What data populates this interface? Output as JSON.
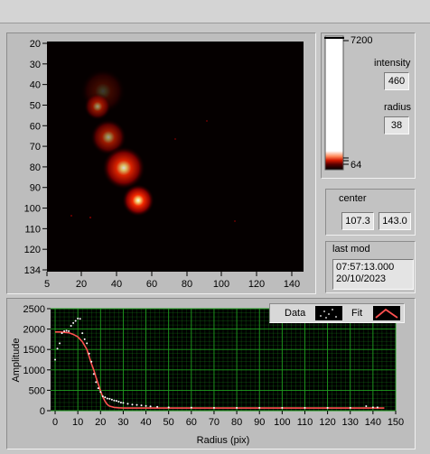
{
  "image_view": {
    "y_ticks": [
      "20",
      "30",
      "40",
      "50",
      "60",
      "70",
      "80",
      "90",
      "100",
      "110",
      "120",
      "134"
    ],
    "x_ticks": [
      "5",
      "20",
      "40",
      "60",
      "80",
      "100",
      "120",
      "140"
    ],
    "blobs": [
      {
        "cx": 107,
        "cy": 65,
        "r": 25,
        "alpha": 0.22
      },
      {
        "cx": 101,
        "cy": 82,
        "r": 15,
        "alpha": 0.55
      },
      {
        "cx": 113,
        "cy": 116,
        "r": 20,
        "alpha": 0.6
      },
      {
        "cx": 130,
        "cy": 150,
        "r": 24,
        "alpha": 0.85
      },
      {
        "cx": 146,
        "cy": 186,
        "r": 18,
        "alpha": 0.95
      }
    ]
  },
  "colorbar": {
    "max_label": "7200",
    "min_label": "64"
  },
  "intensity": {
    "label": "intensity",
    "value": "460"
  },
  "radius": {
    "label": "radius",
    "value": "38"
  },
  "center": {
    "label": "center",
    "x": "107.3",
    "y": "143.0"
  },
  "last_mod": {
    "label": "last mod",
    "time": "07:57:13.000",
    "date": "20/10/2023"
  },
  "legend": {
    "data_label": "Data",
    "fit_label": "Fit"
  },
  "chart_data": {
    "type": "scatter",
    "xlabel": "Radius (pix)",
    "ylabel": "Amplitude",
    "xlim": [
      -2,
      150
    ],
    "ylim": [
      0,
      2500
    ],
    "x_ticks": [
      0,
      10,
      20,
      30,
      40,
      50,
      60,
      70,
      80,
      90,
      100,
      110,
      120,
      130,
      140,
      150
    ],
    "y_ticks": [
      0,
      500,
      1000,
      1500,
      2000,
      2500
    ],
    "grid": true,
    "legend_position": "top-right",
    "colors": {
      "data": "#ffffff",
      "fit": "#ff5050",
      "grid": "#1fa01f",
      "background": "#000000"
    },
    "series": [
      {
        "name": "Data",
        "x": [
          0,
          1,
          2,
          3,
          4,
          5,
          6,
          7,
          8,
          9,
          10,
          11,
          12,
          13,
          14,
          15,
          16,
          17,
          18,
          19,
          20,
          21,
          22,
          23,
          24,
          25,
          26,
          27,
          28,
          29,
          30,
          32,
          34,
          36,
          38,
          40,
          42,
          45,
          50,
          60,
          70,
          80,
          90,
          100,
          110,
          120,
          130,
          137,
          140,
          142
        ],
        "y": [
          1250,
          1520,
          1650,
          1900,
          1950,
          1960,
          1950,
          2080,
          2150,
          2200,
          2260,
          2250,
          1900,
          1750,
          1650,
          1400,
          1200,
          900,
          700,
          550,
          460,
          350,
          330,
          300,
          290,
          270,
          250,
          240,
          220,
          200,
          190,
          170,
          150,
          140,
          130,
          115,
          105,
          95,
          80,
          75,
          70,
          70,
          70,
          70,
          70,
          70,
          70,
          110,
          80,
          80
        ]
      },
      {
        "name": "Fit",
        "x": [
          0,
          2,
          4,
          6,
          8,
          10,
          12,
          14,
          16,
          17,
          18,
          19,
          20,
          21,
          22,
          23,
          24,
          26,
          28,
          30,
          35,
          40,
          60,
          80,
          100,
          120,
          140,
          145
        ],
        "y": [
          1930,
          1930,
          1920,
          1910,
          1870,
          1810,
          1690,
          1500,
          1150,
          1000,
          820,
          650,
          480,
          340,
          230,
          150,
          110,
          80,
          70,
          65,
          65,
          65,
          65,
          65,
          65,
          65,
          65,
          65
        ]
      }
    ]
  }
}
